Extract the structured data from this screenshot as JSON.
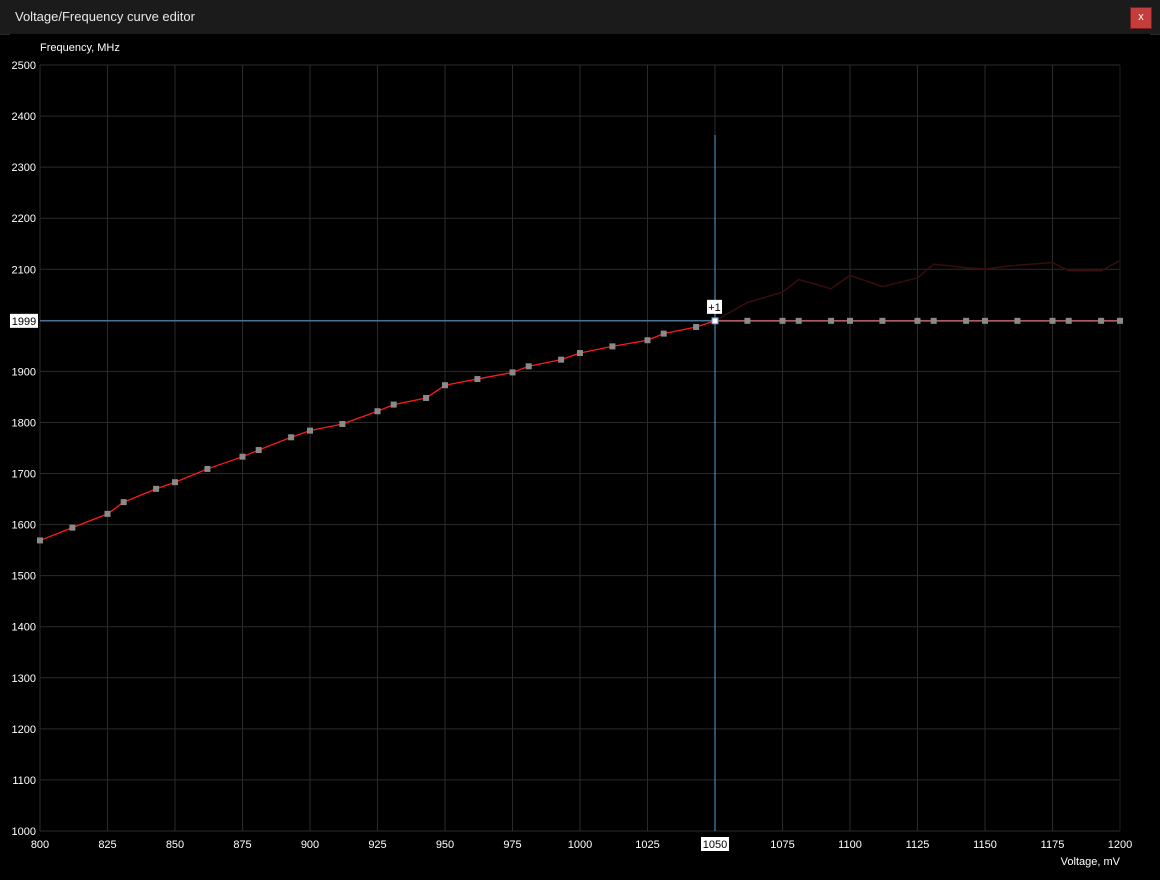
{
  "window": {
    "title": "Voltage/Frequency curve editor",
    "close_label": "x"
  },
  "chart_data": {
    "type": "line",
    "xlabel": "Voltage, mV",
    "ylabel": "Frequency, MHz",
    "xlim": [
      800,
      1200
    ],
    "ylim": [
      1000,
      2500
    ],
    "x_ticks": [
      800,
      825,
      850,
      875,
      900,
      925,
      950,
      975,
      1000,
      1025,
      1050,
      1075,
      1100,
      1125,
      1150,
      1175,
      1200
    ],
    "y_ticks": [
      1000,
      1100,
      1200,
      1300,
      1400,
      1500,
      1600,
      1700,
      1800,
      1900,
      2000,
      2100,
      2200,
      2300,
      2400,
      2500
    ],
    "grid": true,
    "colors": {
      "curve": "#ff1a1a",
      "points": "#8a8a8a",
      "flat_line": "#c06070",
      "default_curve": "#3a0c0c",
      "crosshair": "#5b9bd5",
      "grid": "#2b2b2b",
      "selected_point": "#ffffff"
    },
    "series": [
      {
        "values": [
          [
            800,
            1569
          ],
          [
            812,
            1594
          ],
          [
            825,
            1621
          ],
          [
            831,
            1644
          ],
          [
            843,
            1670
          ],
          [
            850,
            1683
          ],
          [
            862,
            1709
          ],
          [
            875,
            1733
          ],
          [
            881,
            1746
          ],
          [
            893,
            1771
          ],
          [
            900,
            1784
          ],
          [
            912,
            1797
          ],
          [
            925,
            1822
          ],
          [
            931,
            1835
          ],
          [
            943,
            1848
          ],
          [
            950,
            1873
          ],
          [
            962,
            1885
          ],
          [
            975,
            1898
          ],
          [
            981,
            1910
          ],
          [
            993,
            1923
          ],
          [
            1000,
            1936
          ],
          [
            1012,
            1949
          ],
          [
            1025,
            1961
          ],
          [
            1031,
            1974
          ],
          [
            1043,
            1987
          ],
          [
            1050,
            1999
          ],
          [
            1062,
            1999
          ],
          [
            1075,
            1999
          ],
          [
            1081,
            1999
          ],
          [
            1093,
            1999
          ],
          [
            1100,
            1999
          ],
          [
            1112,
            1999
          ],
          [
            1125,
            1999
          ],
          [
            1131,
            1999
          ],
          [
            1143,
            1999
          ],
          [
            1150,
            1999
          ],
          [
            1162,
            1999
          ],
          [
            1175,
            1999
          ],
          [
            1181,
            1999
          ],
          [
            1193,
            1999
          ],
          [
            1200,
            1999
          ]
        ]
      },
      {
        "values": [
          [
            1050,
            1999
          ],
          [
            1062,
            2035
          ],
          [
            1075,
            2055
          ],
          [
            1081,
            2080
          ],
          [
            1093,
            2062
          ],
          [
            1100,
            2088
          ],
          [
            1112,
            2066
          ],
          [
            1125,
            2083
          ],
          [
            1131,
            2110
          ],
          [
            1143,
            2103
          ],
          [
            1150,
            2101
          ],
          [
            1162,
            2108
          ],
          [
            1175,
            2113
          ],
          [
            1181,
            2097
          ],
          [
            1193,
            2097
          ],
          [
            1200,
            2117
          ]
        ]
      }
    ],
    "selected": {
      "x": 1050,
      "y": 1999,
      "x_label": "1050",
      "y_label": "1999",
      "offset_label": "+1"
    }
  }
}
